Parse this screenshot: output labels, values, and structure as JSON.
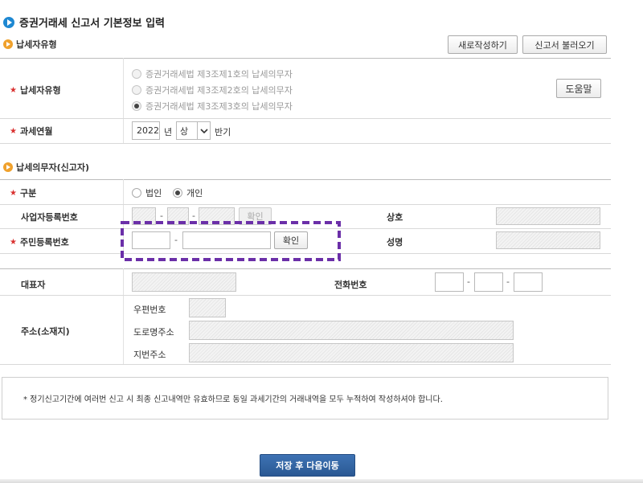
{
  "page_title": "증권거래세 신고서 기본정보 입력",
  "section_taxpayer_type": {
    "title": "납세자유형",
    "new_button": "새로작성하기",
    "load_button": "신고서 불러오기",
    "row_label": "납세자유형",
    "options": [
      "증권거래세법 제3조제1호의 납세의무자",
      "증권거래세법 제3조제2호의 납세의무자",
      "증권거래세법 제3조제3호의 납세의무자"
    ],
    "selected_index": 2,
    "help_button": "도움말",
    "period_label": "과세연월",
    "year": "2022",
    "year_unit": "년",
    "half_select": "상",
    "half_unit": "반기"
  },
  "section_obligor": {
    "title": "납세의무자(신고자)",
    "type_label": "구분",
    "type_options": [
      "법인",
      "개인"
    ],
    "type_selected_index": 1,
    "biz_no_label": "사업자등록번호",
    "biz_confirm": "확인",
    "company_label": "상호",
    "rrn_label": "주민등록번호",
    "rrn_confirm": "확인",
    "name_label": "성명",
    "rep_label": "대표자",
    "phone_label": "전화번호",
    "address_label": "주소(소재지)",
    "postal_label": "우편번호",
    "road_label": "도로명주소",
    "lot_label": "지번주소"
  },
  "notice": "* 정기신고기간에 여러번 신고 시 최종 신고내역만 유효하므로 동일 과세기간의 거래내역을 모두 누적하여 작성하셔야 합니다.",
  "save_button": "저장 후 다음이동",
  "colors": {
    "primary_button": "#2f5f9e",
    "required_star": "#d9302f",
    "section_icon": "#f0a12c",
    "title_icon": "#1e88d2",
    "highlight_dash": "#6b2fa8"
  }
}
